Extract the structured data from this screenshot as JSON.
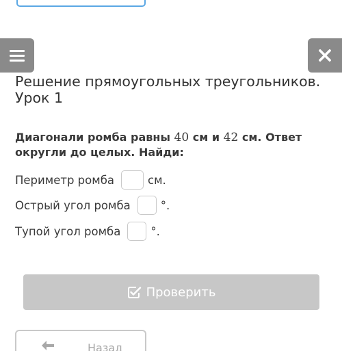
{
  "header": {
    "menu_icon": "hamburger-icon",
    "close_icon": "close-icon",
    "lesson_title": "Решение прямоугольных треугольников. Урок 1"
  },
  "task": {
    "text_prefix": "Диагонали ромба равны",
    "d1": "40",
    "unit1": "см и",
    "d2": "42",
    "unit2": "см. Ответ округли до целых. Найди:"
  },
  "questions": [
    {
      "label": "Периметр ромба",
      "value": "",
      "unit": "см."
    },
    {
      "label": "Острый угол ромба",
      "value": "",
      "unit": "°."
    },
    {
      "label": "Тупой угол ромба",
      "value": "",
      "unit": "°."
    }
  ],
  "actions": {
    "check_label": "Проверить",
    "check_icon": "checkbox-pencil-icon",
    "back_label": "Назад",
    "back_icon": "arrow-left-icon"
  },
  "colors": {
    "menu_bg": "#8a8a8a",
    "check_bg": "#c7c7c7",
    "top_outline": "#5aa7e4"
  }
}
